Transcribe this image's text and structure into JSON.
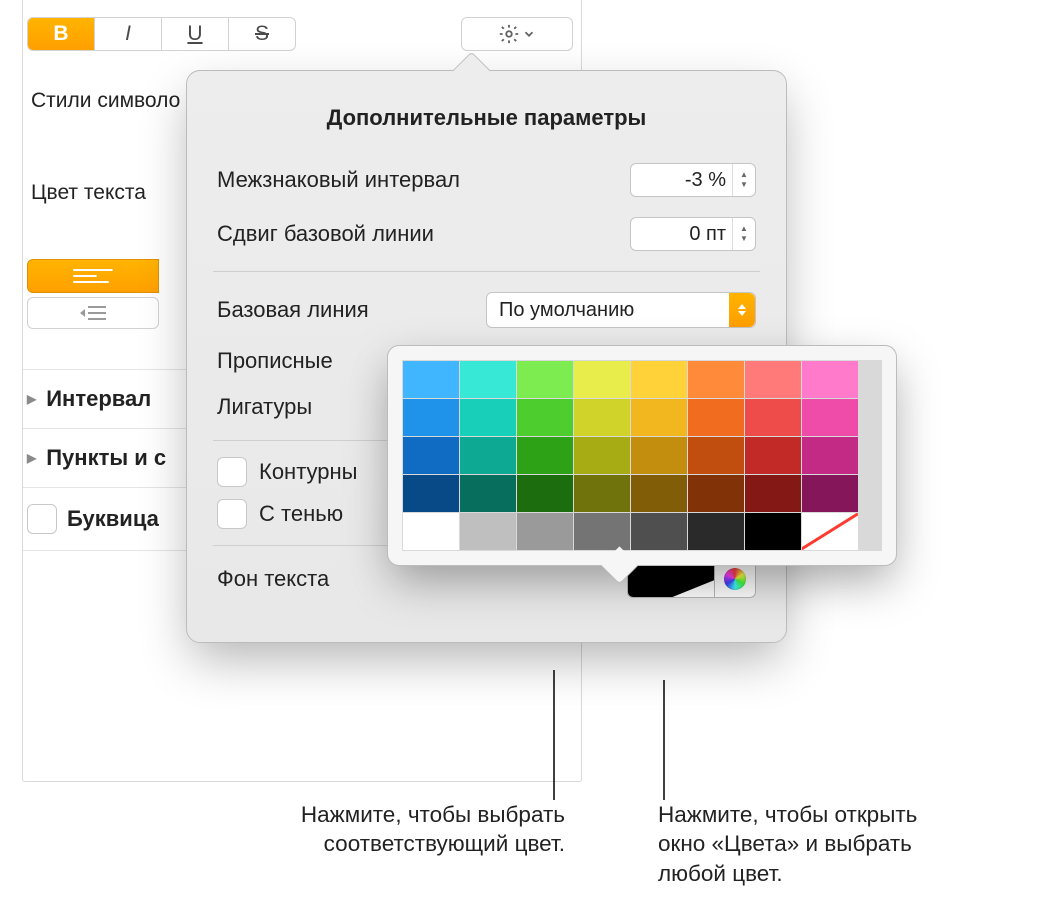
{
  "toolbar": {
    "bold": "B",
    "italic": "I",
    "underline": "U",
    "strike": "S"
  },
  "sidebar": {
    "char_styles": "Стили символо",
    "text_color": "Цвет текста",
    "spacing": "Интервал",
    "bullets": "Пункты и с",
    "dropcap": "Буквица"
  },
  "popover": {
    "title": "Дополнительные параметры",
    "tracking_label": "Межзнаковый интервал",
    "tracking_value": "-3 %",
    "baseline_shift_label": "Сдвиг базовой линии",
    "baseline_shift_value": "0 пт",
    "baseline_label": "Базовая линия",
    "baseline_value": "По умолчанию",
    "caps": "Прописные",
    "ligatures": "Лигатуры",
    "outline": "Контурны",
    "shadow": "С тенью",
    "text_bg": "Фон текста"
  },
  "color_grid": {
    "rows": [
      [
        "#3fb6ff",
        "#38e8d7",
        "#7cec50",
        "#e9ed4c",
        "#ffd23a",
        "#ff8a3a",
        "#ff7a78",
        "#ff7acb"
      ],
      [
        "#1f92ea",
        "#18d0b9",
        "#4dcd2e",
        "#cfd32a",
        "#f2b61f",
        "#f26c1f",
        "#ee4c4a",
        "#ee4ca8"
      ],
      [
        "#0f6cc2",
        "#0da993",
        "#2ea217",
        "#a7ab14",
        "#c38d0e",
        "#c14d0e",
        "#c22a28",
        "#c22a85"
      ],
      [
        "#084a88",
        "#076e5e",
        "#1c6d0d",
        "#70730b",
        "#825d07",
        "#813207",
        "#841815",
        "#841659"
      ],
      [
        "#ffffff",
        "#bfbfbf",
        "#9a9a9a",
        "#747474",
        "#4f4f4f",
        "#2a2a2a",
        "#000000",
        "none"
      ]
    ]
  },
  "callouts": {
    "left1": "Нажмите, чтобы выбрать",
    "left2": "соответствующий цвет.",
    "right1": "Нажмите, чтобы открыть",
    "right2": "окно «Цвета» и выбрать",
    "right3": "любой цвет."
  }
}
